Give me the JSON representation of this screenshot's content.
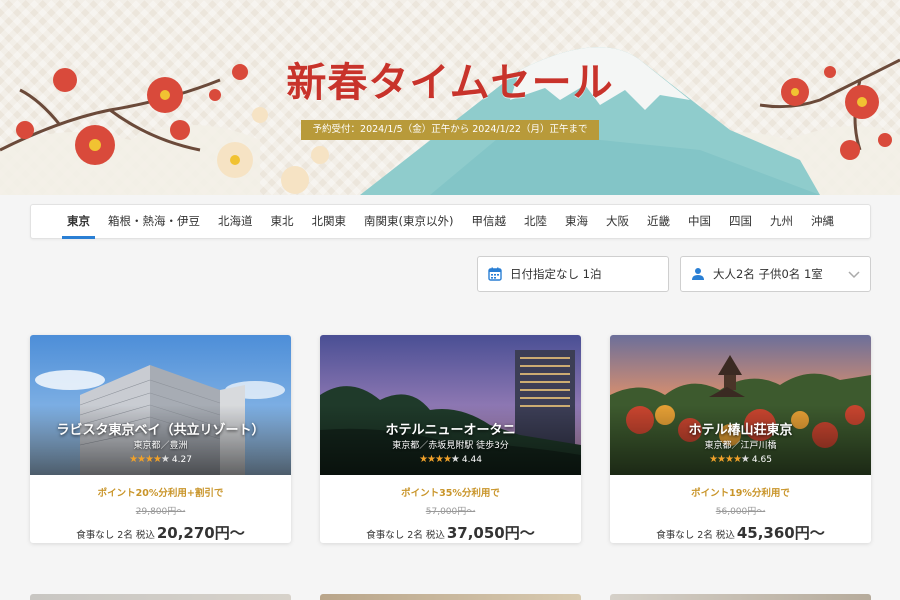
{
  "banner": {
    "title": "新春タイムセール",
    "period": "予約受付：2024/1/5（金）正午から 2024/1/22（月）正午まで"
  },
  "region_tabs": [
    {
      "label": "東京",
      "active": true
    },
    {
      "label": "箱根・熱海・伊豆",
      "active": false
    },
    {
      "label": "北海道",
      "active": false
    },
    {
      "label": "東北",
      "active": false
    },
    {
      "label": "北関東",
      "active": false
    },
    {
      "label": "南関東(東京以外)",
      "active": false
    },
    {
      "label": "甲信越",
      "active": false
    },
    {
      "label": "北陸",
      "active": false
    },
    {
      "label": "東海",
      "active": false
    },
    {
      "label": "大阪",
      "active": false
    },
    {
      "label": "近畿",
      "active": false
    },
    {
      "label": "中国",
      "active": false
    },
    {
      "label": "四国",
      "active": false
    },
    {
      "label": "九州",
      "active": false
    },
    {
      "label": "沖縄",
      "active": false
    }
  ],
  "filters": {
    "date": "日付指定なし 1泊",
    "guests": "大人2名 子供0名 1室",
    "accent_color": "#2a7fd4"
  },
  "hotels": [
    {
      "name": "ラビスタ東京ベイ（共立リゾート）",
      "location": "東京都／豊洲",
      "stars": "★★★★",
      "star_last": "★",
      "rating": "4.27",
      "promo": "ポイント20%分利用+割引で",
      "original_price": "29,800円〜",
      "conditions": "食事なし 2名 税込",
      "price": "20,270円〜"
    },
    {
      "name": "ホテルニューオータニ",
      "location": "東京都／赤坂見附駅 徒歩3分",
      "stars": "★★★★",
      "star_last": "★",
      "rating": "4.44",
      "promo": "ポイント35%分利用で",
      "original_price": "57,000円〜",
      "conditions": "食事なし 2名 税込",
      "price": "37,050円〜"
    },
    {
      "name": "ホテル椿山荘東京",
      "location": "東京都／江戸川橋",
      "stars": "★★★★",
      "star_last": "★",
      "rating": "4.65",
      "promo": "ポイント19%分利用で",
      "original_price": "56,000円〜",
      "conditions": "食事なし 2名 税込",
      "price": "45,360円〜"
    }
  ]
}
